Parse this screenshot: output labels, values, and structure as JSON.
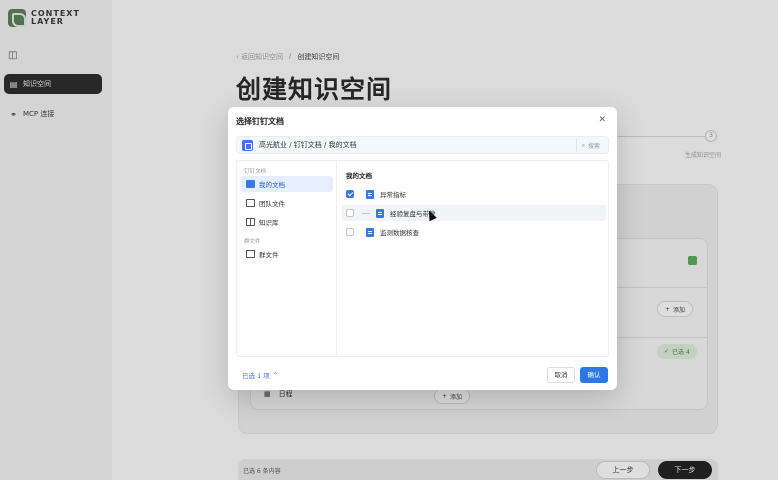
{
  "app": {
    "logo_line1": "CONTEXT",
    "logo_line2": "LAYER",
    "brand_color": "#5b7d5c"
  },
  "sidebar": {
    "toggle_icon": "sidebar-toggle-icon",
    "items": [
      {
        "label": "知识空间",
        "icon": "document-icon",
        "active": true
      },
      {
        "label": "MCP 连接",
        "icon": "link-icon",
        "active": false
      }
    ]
  },
  "page": {
    "breadcrumb_back": "返回知识空间",
    "breadcrumb_sep": "/",
    "breadcrumb_current": "创建知识空间",
    "title": "创建知识空间",
    "step_number": "3",
    "step_label": "生成知识空间"
  },
  "background": {
    "add_label": "添加",
    "selected_label": "已选 4",
    "schedule_label": "日程",
    "footer_count": "已选 6 条内容",
    "prev_label": "上一步",
    "next_label": "下一步"
  },
  "modal": {
    "title": "选择钉钉文档",
    "close_icon": "close-icon",
    "path": "高光航业 / 钉钉文档 / 我的文档",
    "search_placeholder": "搜索",
    "left_sections": [
      {
        "header": "钉钉文档",
        "items": [
          {
            "label": "我的文档",
            "icon": "folder-icon",
            "active": true
          },
          {
            "label": "团队文件",
            "icon": "team-folder-icon",
            "active": false
          },
          {
            "label": "知识库",
            "icon": "book-icon",
            "active": false
          }
        ]
      },
      {
        "header": "群文件",
        "items": [
          {
            "label": "群文件",
            "icon": "group-folder-icon",
            "active": false
          }
        ]
      }
    ],
    "right_header": "我的文档",
    "documents": [
      {
        "name": "异常指标",
        "checked": true
      },
      {
        "name": "经验复盘与带教",
        "checked": false
      },
      {
        "name": "监测数据核查",
        "checked": false
      }
    ],
    "selected_count": "已选 1 项",
    "cancel_label": "取消",
    "confirm_label": "确认",
    "accent_color": "#2f76e6"
  }
}
